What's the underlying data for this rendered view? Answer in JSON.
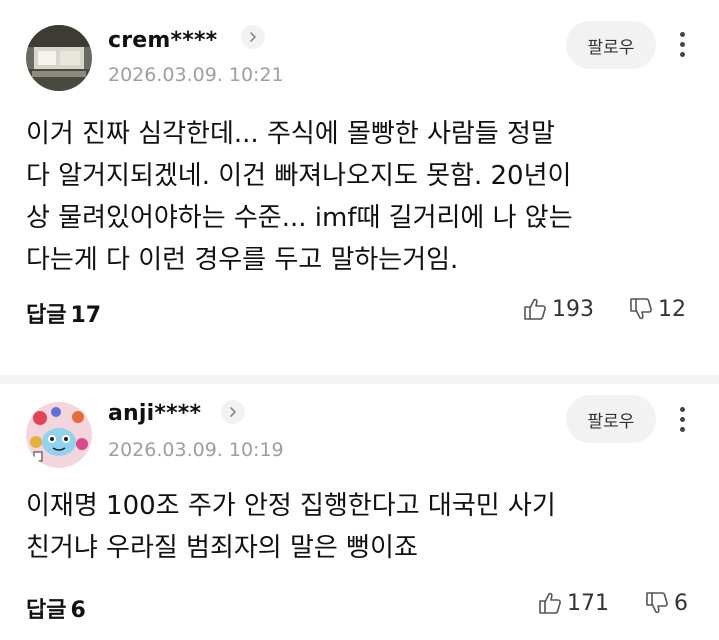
{
  "follow_label": "팔로우",
  "reply_label": "답글",
  "comments": [
    {
      "username": "crem****",
      "timestamp": "2026.03.09. 10:21",
      "lines": [
        "이거 진짜 심각한데... 주식에 몰빵한 사람들 정말",
        "다 알거지되겠네. 이건 빠져나오지도 못함. 20년이",
        "상 물려있어야하는 수준... imf때 길거리에 나 앉는",
        "다는게 다 이런 경우를 두고 말하는거임."
      ],
      "reply_count": "17",
      "likes": "193",
      "dislikes": "12",
      "avatar_icon": "profile-photo"
    },
    {
      "username": "anji****",
      "timestamp": "2026.03.09. 10:19",
      "lines": [
        "이재명 100조 주가 안정 집행한다고 대국민 사기",
        "친거냐 우라질 범죄자의 말은 뻥이죠"
      ],
      "reply_count": "6",
      "likes": "171",
      "dislikes": "6",
      "avatar_icon": "character-profile-image"
    }
  ],
  "colors": {
    "text": "#111111",
    "timestamp": "#9e9e9e",
    "button_bg": "#f2f2f2",
    "divider": "#f3f3f3"
  }
}
